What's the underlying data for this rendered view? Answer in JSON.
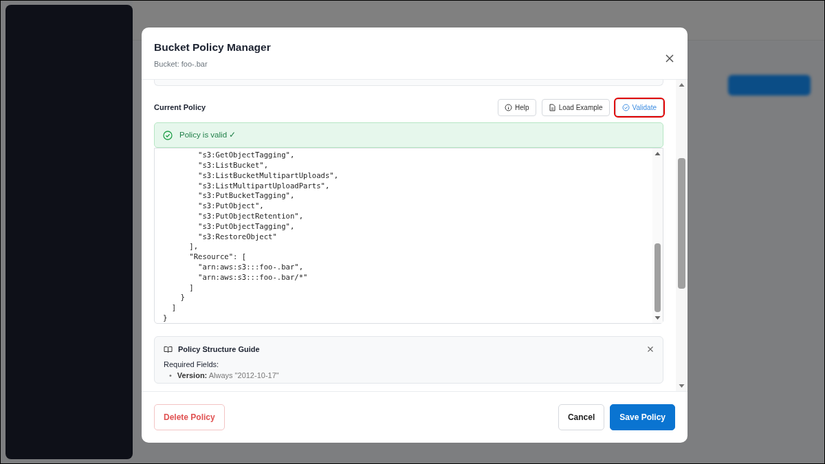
{
  "dialog": {
    "title": "Bucket Policy Manager",
    "subtitle": "Bucket: foo-.bar"
  },
  "section": {
    "title": "Current Policy",
    "tools": [
      {
        "label": "Help",
        "kind": "help",
        "highlighted": false
      },
      {
        "label": "Load Example",
        "kind": "example",
        "highlighted": false
      },
      {
        "label": "Validate",
        "kind": "validate",
        "highlighted": true
      }
    ]
  },
  "status": {
    "kind": "success",
    "text": "Policy is valid ✓"
  },
  "editor": {
    "lines": [
      "        \"s3:GetObjectTagging\",",
      "        \"s3:ListBucket\",",
      "        \"s3:ListBucketMultipartUploads\",",
      "        \"s3:ListMultipartUploadParts\",",
      "        \"s3:PutBucketTagging\",",
      "        \"s3:PutObject\",",
      "        \"s3:PutObjectRetention\",",
      "        \"s3:PutObjectTagging\",",
      "        \"s3:RestoreObject\"",
      "      ],",
      "      \"Resource\": [",
      "        \"arn:aws:s3:::foo-.bar\",",
      "        \"arn:aws:s3:::foo-.bar/*\"",
      "      ]",
      "    }",
      "  ]",
      "}"
    ]
  },
  "guide": {
    "title": "Policy Structure Guide",
    "heading": "Required Fields:",
    "items": [
      {
        "bullet": "•",
        "term": "Version:",
        "text": "Always \"2012-10-17\""
      }
    ]
  },
  "footer": {
    "delete": "Delete Policy",
    "cancel": "Cancel",
    "save": "Save Policy"
  }
}
